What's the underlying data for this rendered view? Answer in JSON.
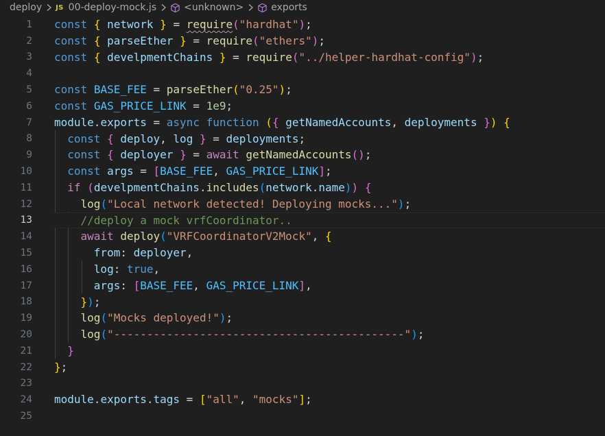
{
  "breadcrumb": {
    "items": [
      "deploy",
      "00-deploy-mock.js",
      "<unknown>",
      "exports"
    ],
    "file_badge": "JS"
  },
  "editor": {
    "active_line": 13,
    "line_numbers": [
      "1",
      "2",
      "3",
      "4",
      "5",
      "6",
      "7",
      "8",
      "9",
      "10",
      "11",
      "12",
      "13",
      "14",
      "15",
      "16",
      "17",
      "18",
      "19",
      "20",
      "21",
      "22",
      "23",
      "24",
      "25"
    ],
    "lines": [
      [
        [
          "kw",
          "const"
        ],
        [
          "op",
          " "
        ],
        [
          "b1",
          "{"
        ],
        [
          "op",
          " "
        ],
        [
          "var",
          "network"
        ],
        [
          "op",
          " "
        ],
        [
          "b1",
          "}"
        ],
        [
          "op",
          " = "
        ],
        [
          "fn",
          "require"
        ],
        [
          "b2",
          "("
        ],
        [
          "str",
          "\"hardhat\""
        ],
        [
          "b2",
          ")"
        ],
        [
          "op",
          ";"
        ]
      ],
      [
        [
          "kw",
          "const"
        ],
        [
          "op",
          " "
        ],
        [
          "b1",
          "{"
        ],
        [
          "op",
          " "
        ],
        [
          "var",
          "parseEther"
        ],
        [
          "op",
          " "
        ],
        [
          "b1",
          "}"
        ],
        [
          "op",
          " = "
        ],
        [
          "fn",
          "require"
        ],
        [
          "b2",
          "("
        ],
        [
          "str",
          "\"ethers\""
        ],
        [
          "b2",
          ")"
        ],
        [
          "op",
          ";"
        ]
      ],
      [
        [
          "kw",
          "const"
        ],
        [
          "op",
          " "
        ],
        [
          "b1",
          "{"
        ],
        [
          "op",
          " "
        ],
        [
          "var",
          "develpmentChains"
        ],
        [
          "op",
          " "
        ],
        [
          "b1",
          "}"
        ],
        [
          "op",
          " = "
        ],
        [
          "fn",
          "require"
        ],
        [
          "b2",
          "("
        ],
        [
          "str",
          "\"../helper-hardhat-config\""
        ],
        [
          "b2",
          ")"
        ],
        [
          "op",
          ";"
        ]
      ],
      [],
      [
        [
          "kw",
          "const"
        ],
        [
          "op",
          " "
        ],
        [
          "cst",
          "BASE_FEE"
        ],
        [
          "op",
          " = "
        ],
        [
          "fn",
          "parseEther"
        ],
        [
          "b1",
          "("
        ],
        [
          "str",
          "\"0.25\""
        ],
        [
          "b1",
          ")"
        ],
        [
          "op",
          ";"
        ]
      ],
      [
        [
          "kw",
          "const"
        ],
        [
          "op",
          " "
        ],
        [
          "cst",
          "GAS_PRICE_LINK"
        ],
        [
          "op",
          " = "
        ],
        [
          "num",
          "1e9"
        ],
        [
          "op",
          ";"
        ]
      ],
      [
        [
          "var",
          "module"
        ],
        [
          "op",
          "."
        ],
        [
          "var",
          "exports"
        ],
        [
          "op",
          " = "
        ],
        [
          "kw",
          "async"
        ],
        [
          "op",
          " "
        ],
        [
          "kw",
          "function"
        ],
        [
          "op",
          " "
        ],
        [
          "b1",
          "("
        ],
        [
          "b2",
          "{"
        ],
        [
          "op",
          " "
        ],
        [
          "var",
          "getNamedAccounts"
        ],
        [
          "op",
          ", "
        ],
        [
          "var",
          "deployments"
        ],
        [
          "op",
          " "
        ],
        [
          "b2",
          "}"
        ],
        [
          "b1",
          ")"
        ],
        [
          "op",
          " "
        ],
        [
          "b1",
          "{"
        ]
      ],
      [
        [
          "op",
          "  "
        ],
        [
          "kw",
          "const"
        ],
        [
          "op",
          " "
        ],
        [
          "b2",
          "{"
        ],
        [
          "op",
          " "
        ],
        [
          "var",
          "deploy"
        ],
        [
          "op",
          ", "
        ],
        [
          "var",
          "log"
        ],
        [
          "op",
          " "
        ],
        [
          "b2",
          "}"
        ],
        [
          "op",
          " = "
        ],
        [
          "var",
          "deployments"
        ],
        [
          "op",
          ";"
        ]
      ],
      [
        [
          "op",
          "  "
        ],
        [
          "kw",
          "const"
        ],
        [
          "op",
          " "
        ],
        [
          "b2",
          "{"
        ],
        [
          "op",
          " "
        ],
        [
          "var",
          "deployer"
        ],
        [
          "op",
          " "
        ],
        [
          "b2",
          "}"
        ],
        [
          "op",
          " = "
        ],
        [
          "ctl",
          "await"
        ],
        [
          "op",
          " "
        ],
        [
          "fn",
          "getNamedAccounts"
        ],
        [
          "b2",
          "()"
        ],
        [
          "op",
          ";"
        ]
      ],
      [
        [
          "op",
          "  "
        ],
        [
          "kw",
          "const"
        ],
        [
          "op",
          " "
        ],
        [
          "var",
          "args"
        ],
        [
          "op",
          " = "
        ],
        [
          "b2",
          "["
        ],
        [
          "cst",
          "BASE_FEE"
        ],
        [
          "op",
          ", "
        ],
        [
          "cst",
          "GAS_PRICE_LINK"
        ],
        [
          "b2",
          "]"
        ],
        [
          "op",
          ";"
        ]
      ],
      [
        [
          "op",
          "  "
        ],
        [
          "ctl",
          "if"
        ],
        [
          "op",
          " "
        ],
        [
          "b2",
          "("
        ],
        [
          "var",
          "develpmentChains"
        ],
        [
          "op",
          "."
        ],
        [
          "fn",
          "includes"
        ],
        [
          "b3",
          "("
        ],
        [
          "var",
          "network"
        ],
        [
          "op",
          "."
        ],
        [
          "var",
          "name"
        ],
        [
          "b3",
          ")"
        ],
        [
          "b2",
          ")"
        ],
        [
          "op",
          " "
        ],
        [
          "b2",
          "{"
        ]
      ],
      [
        [
          "op",
          "    "
        ],
        [
          "fn",
          "log"
        ],
        [
          "b3",
          "("
        ],
        [
          "str",
          "\"Local network detected! Deploying mocks...\""
        ],
        [
          "b3",
          ")"
        ],
        [
          "op",
          ";"
        ]
      ],
      [
        [
          "op",
          "    "
        ],
        [
          "cmt",
          "//deploy a mock vrfCoordinator.."
        ]
      ],
      [
        [
          "op",
          "    "
        ],
        [
          "ctl",
          "await"
        ],
        [
          "op",
          " "
        ],
        [
          "fn",
          "deploy"
        ],
        [
          "b3",
          "("
        ],
        [
          "str",
          "\"VRFCoordinatorV2Mock\""
        ],
        [
          "op",
          ", "
        ],
        [
          "b1",
          "{"
        ]
      ],
      [
        [
          "op",
          "      "
        ],
        [
          "var",
          "from"
        ],
        [
          "op",
          ": "
        ],
        [
          "var",
          "deployer"
        ],
        [
          "op",
          ","
        ]
      ],
      [
        [
          "op",
          "      "
        ],
        [
          "var",
          "log"
        ],
        [
          "op",
          ": "
        ],
        [
          "kw",
          "true"
        ],
        [
          "op",
          ","
        ]
      ],
      [
        [
          "op",
          "      "
        ],
        [
          "var",
          "args"
        ],
        [
          "op",
          ": "
        ],
        [
          "b2",
          "["
        ],
        [
          "cst",
          "BASE_FEE"
        ],
        [
          "op",
          ", "
        ],
        [
          "cst",
          "GAS_PRICE_LINK"
        ],
        [
          "b2",
          "]"
        ],
        [
          "op",
          ","
        ]
      ],
      [
        [
          "op",
          "    "
        ],
        [
          "b1",
          "}"
        ],
        [
          "b3",
          ")"
        ],
        [
          "op",
          ";"
        ]
      ],
      [
        [
          "op",
          "    "
        ],
        [
          "fn",
          "log"
        ],
        [
          "b3",
          "("
        ],
        [
          "str",
          "\"Mocks deployed!\""
        ],
        [
          "b3",
          ")"
        ],
        [
          "op",
          ";"
        ]
      ],
      [
        [
          "op",
          "    "
        ],
        [
          "fn",
          "log"
        ],
        [
          "b3",
          "("
        ],
        [
          "str",
          "\"--------------------------------------------\""
        ],
        [
          "b3",
          ")"
        ],
        [
          "op",
          ";"
        ]
      ],
      [
        [
          "op",
          "  "
        ],
        [
          "b2",
          "}"
        ]
      ],
      [
        [
          "b1",
          "}"
        ],
        [
          "op",
          ";"
        ]
      ],
      [],
      [
        [
          "var",
          "module"
        ],
        [
          "op",
          "."
        ],
        [
          "var",
          "exports"
        ],
        [
          "op",
          "."
        ],
        [
          "var",
          "tags"
        ],
        [
          "op",
          " = "
        ],
        [
          "b1",
          "["
        ],
        [
          "str",
          "\"all\""
        ],
        [
          "op",
          ", "
        ],
        [
          "str",
          "\"mocks\""
        ],
        [
          "b1",
          "]"
        ],
        [
          "op",
          ";"
        ]
      ],
      []
    ]
  }
}
